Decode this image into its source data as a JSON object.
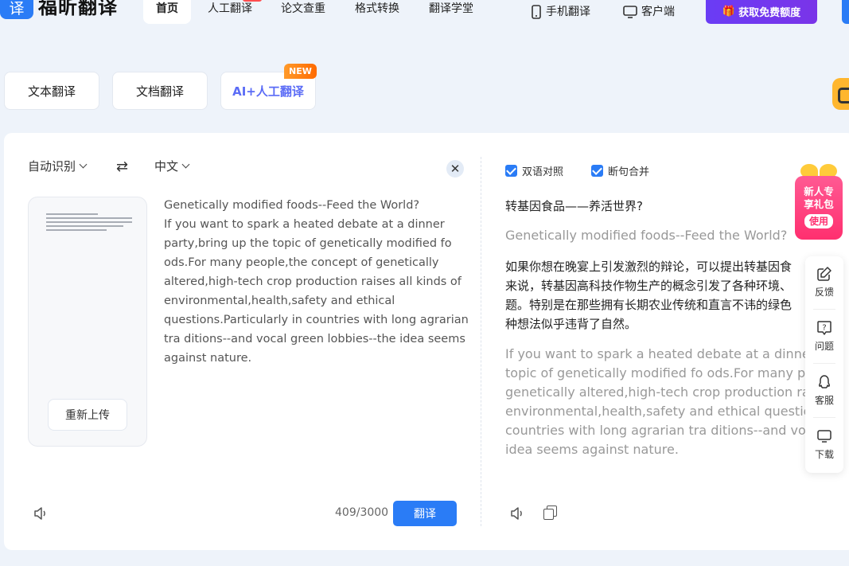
{
  "header": {
    "logo_mark": "译",
    "logo_text": "福昕翻译",
    "nav": [
      "首页",
      "人工翻译",
      "论文查重",
      "格式转换",
      "翻译学堂"
    ],
    "mobile": "手机翻译",
    "desktop": "客户端",
    "promo": "获取免费额度",
    "promo_icon": "gift-icon"
  },
  "tabs": [
    "文本翻译",
    "文档翻译",
    "AI+人工翻译"
  ],
  "new_badge": "NEW",
  "source": {
    "lang": "自动识别",
    "target_lang": "中文",
    "reupload": "重新上传",
    "lines": [
      "Genetically modified foods--Feed the World?",
      "If you want to spark a heated debate at a dinner",
      "party,bring up the topic of genetically modified fo",
      "ods.For many people,the concept of genetically",
      "altered,high-tech crop production raises all kinds of",
      "environmental,health,safety and ethical",
      "questions.Particularly in countries with long agrarian",
      "tra ditions--and vocal green lobbies--the idea seems",
      "against nature."
    ],
    "counter": "409/3000",
    "translate_btn": "翻译"
  },
  "options": {
    "bilingual": "双语对照",
    "merge": "断句合并"
  },
  "output": {
    "title_cn": "转基因食品——养活世界?",
    "title_en": "Genetically modified foods--Feed the World?",
    "para_cn": [
      "如果你想在晚宴上引发激烈的辩论，可以提出转基因食",
      "来说，转基因高科技作物生产的概念引发了各种环境、",
      "题。特别是在那些拥有长期农业传统和直言不讳的绿色",
      "种想法似乎违背了自然。"
    ],
    "para_en": [
      "If you want to spark a heated debate at a dinner p",
      "topic of genetically modified fo ods.For many peo",
      "genetically altered,high-tech crop production rais",
      "environmental,health,safety and ethical questions",
      "countries with long agrarian tra ditions--and voca",
      "idea seems against nature."
    ]
  },
  "gift": {
    "line1": "新人专",
    "line2": "享礼包",
    "use": "使用"
  },
  "toolbar": [
    "反馈",
    "问题",
    "客服",
    "下载"
  ],
  "colors": {
    "accent": "#2a7cf6",
    "promo": "#6a3cf5",
    "gift": "#ff2f6f"
  }
}
